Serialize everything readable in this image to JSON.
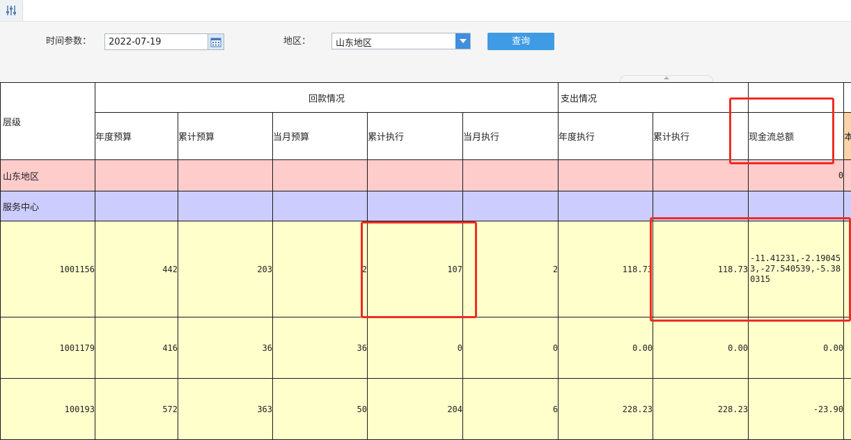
{
  "filters": {
    "time_label": "时间参数：",
    "date_value": "2022-07-19",
    "region_label": "地区：",
    "region_value": "山东地区",
    "query_label": "查询"
  },
  "table": {
    "level_header": "层级",
    "group_receipts": "回款情况",
    "group_expense": "支出情况",
    "columns": [
      "年度预算",
      "累计预算",
      "当月预算",
      "累计执行",
      "当月执行",
      "年度执行",
      "累计执行",
      "现金流总额",
      "本"
    ],
    "region_row": {
      "name": "山东地区",
      "cashflow": "0"
    },
    "center_row": {
      "name": "服务中心"
    },
    "rows": [
      {
        "id": "1001156",
        "annual_budget": "442",
        "cumulative_budget": "203",
        "month_budget": "2",
        "cumulative_exec": "107",
        "month_exec": "2",
        "exp_annual_exec": "118.73",
        "exp_cumulative_exec": "118.73",
        "cashflow": "-11.41231,-2.190453,-27.540539,-5.380315"
      },
      {
        "id": "1001179",
        "annual_budget": "416",
        "cumulative_budget": "36",
        "month_budget": "36",
        "cumulative_exec": "0",
        "month_exec": "0",
        "exp_annual_exec": "0.00",
        "exp_cumulative_exec": "0.00",
        "cashflow": "0.00"
      },
      {
        "id": "100193",
        "annual_budget": "572",
        "cumulative_budget": "363",
        "month_budget": "50",
        "cumulative_exec": "204",
        "month_exec": "6",
        "exp_annual_exec": "228.23",
        "exp_cumulative_exec": "228.23",
        "cashflow": "-23.90"
      }
    ]
  },
  "icons": [
    "settings-sliders-icon",
    "calendar-icon",
    "chevron-down-icon"
  ],
  "colors": {
    "region_row": "#ffcccc",
    "center_row": "#ccccff",
    "data_rows": "#ffffcc",
    "query_button": "#3f9be3",
    "annotation": "#ee2c22"
  }
}
